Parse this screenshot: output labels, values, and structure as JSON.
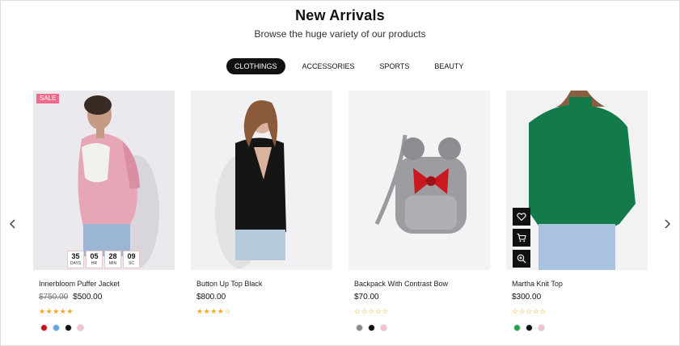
{
  "section": {
    "title": "New Arrivals",
    "subtitle": "Browse the huge variety of our products"
  },
  "tabs": [
    {
      "label": "CLOTHINGS",
      "active": true
    },
    {
      "label": "ACCESSORIES",
      "active": false
    },
    {
      "label": "SPORTS",
      "active": false
    },
    {
      "label": "BEAUTY",
      "active": false
    }
  ],
  "nav": {
    "prev_icon": "chevron-left-icon",
    "next_icon": "chevron-right-icon"
  },
  "products": [
    {
      "name": "Innerbloom Puffer Jacket",
      "old_price": "$750.00",
      "price": "$500.00",
      "badge": "SALE",
      "rating": 5,
      "countdown": [
        {
          "num": "35",
          "unit": "DAYS"
        },
        {
          "num": "05",
          "unit": "HR"
        },
        {
          "num": "28",
          "unit": "MIN"
        },
        {
          "num": "09",
          "unit": "SC"
        }
      ],
      "swatches": [
        "#c0151b",
        "#5aa9e6",
        "#111111",
        "#f7c1cc"
      ]
    },
    {
      "name": "Button Up Top Black",
      "old_price": "",
      "price": "$800.00",
      "rating": 4,
      "swatches": []
    },
    {
      "name": "Backpack With Contrast Bow",
      "old_price": "",
      "price": "$70.00",
      "rating": 0,
      "swatches": [
        "#8a8a8a",
        "#111111",
        "#f7c1cc"
      ]
    },
    {
      "name": "Martha Knit Top",
      "old_price": "",
      "price": "$300.00",
      "rating": 0,
      "actions": [
        "heart-icon",
        "cart-icon",
        "zoom-icon"
      ],
      "swatches": [
        "#1fa64a",
        "#111111",
        "#f7c1cc"
      ]
    }
  ],
  "colors": {
    "accent": "#111111",
    "sale_badge": "#f06b8a",
    "star": "#f5a623"
  }
}
